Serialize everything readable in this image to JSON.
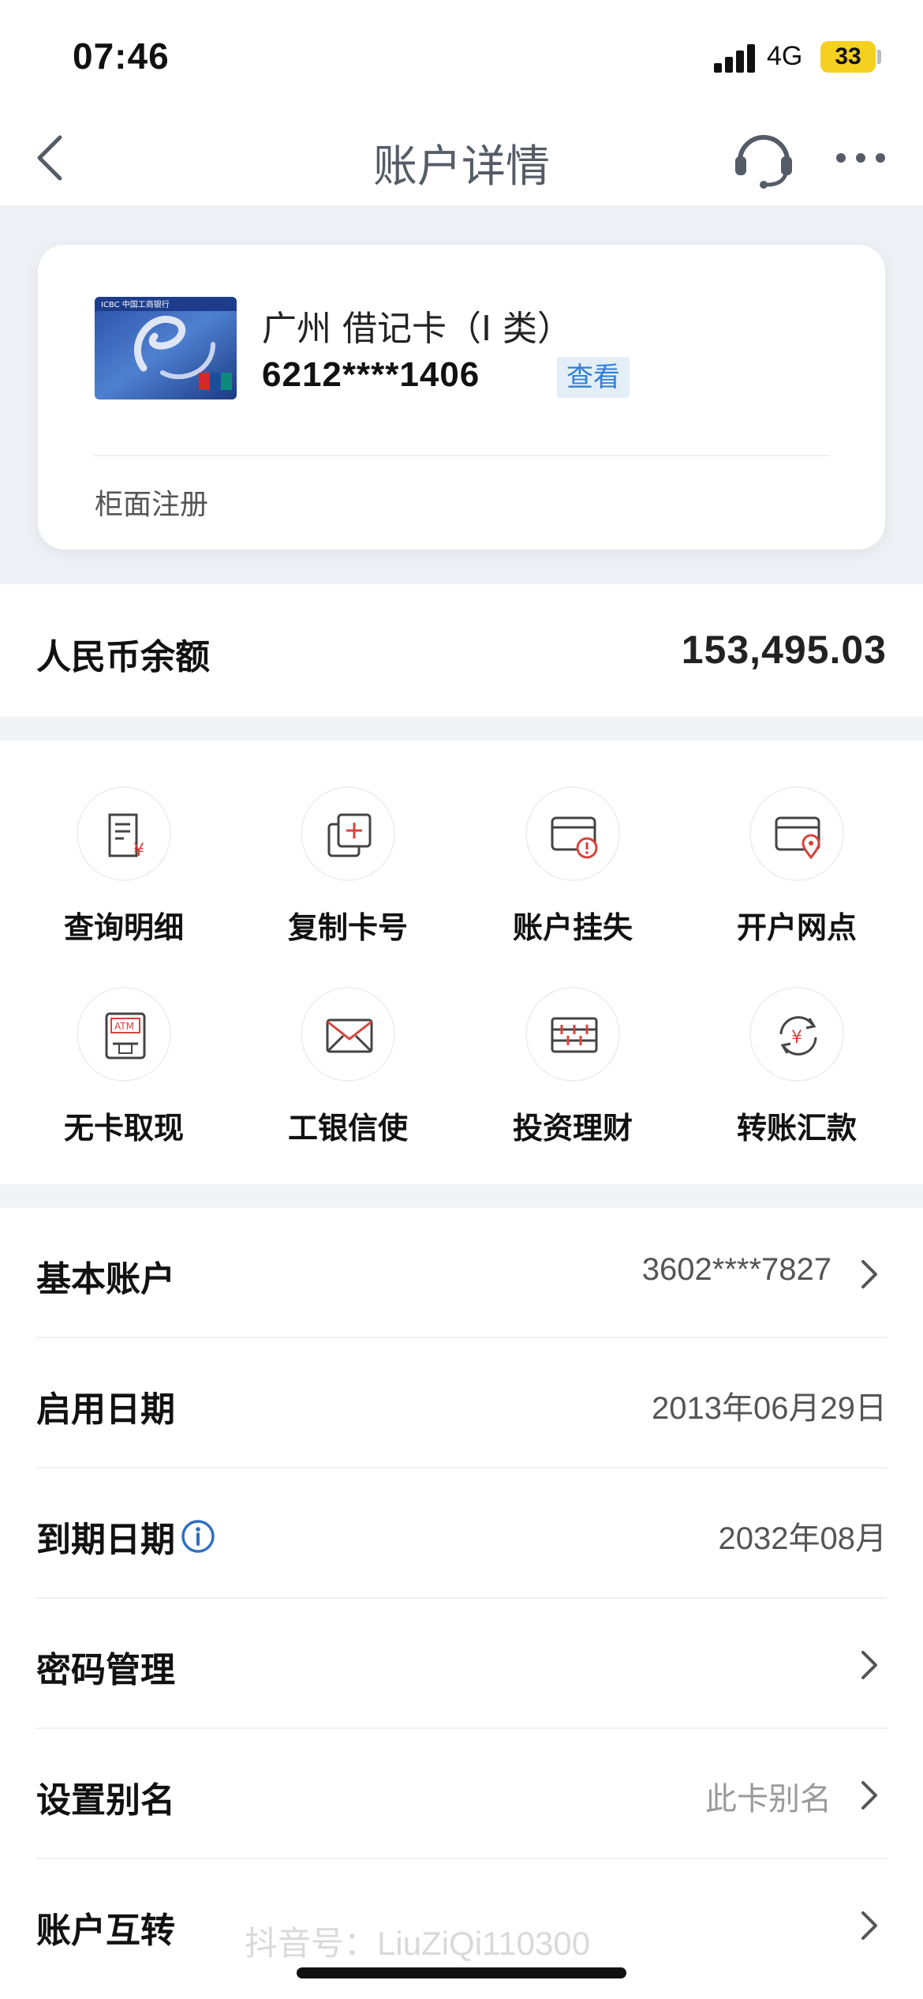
{
  "status_bar": {
    "time": "07:46",
    "network": "4G",
    "battery": "33"
  },
  "nav": {
    "title": "账户详情"
  },
  "card": {
    "name": "广州 借记卡（I 类）",
    "number": "6212****1406",
    "view_label": "查看",
    "registration": "柜面注册",
    "image_bank_text": "ICBC 中国工商银行"
  },
  "balance": {
    "label": "人民币余额",
    "value": "153,495.03"
  },
  "actions": [
    {
      "label": "查询明细",
      "icon": "statement-icon"
    },
    {
      "label": "复制卡号",
      "icon": "copy-icon"
    },
    {
      "label": "账户挂失",
      "icon": "card-alert-icon"
    },
    {
      "label": "开户网点",
      "icon": "card-location-icon"
    },
    {
      "label": "无卡取现",
      "icon": "atm-icon"
    },
    {
      "label": "工银信使",
      "icon": "envelope-icon"
    },
    {
      "label": "投资理财",
      "icon": "abacus-icon"
    },
    {
      "label": "转账汇款",
      "icon": "transfer-icon"
    }
  ],
  "atm_text": "ATM",
  "details": [
    {
      "label": "基本账户",
      "value": "3602****7827",
      "chevron": true
    },
    {
      "label": "启用日期",
      "value": "2013年06月29日",
      "chevron": false
    },
    {
      "label": "到期日期",
      "value": "2032年08月",
      "chevron": false,
      "info": true
    },
    {
      "label": "密码管理",
      "value": "",
      "chevron": true
    },
    {
      "label": "设置别名",
      "value": "此卡别名",
      "chevron": true,
      "placeholder": true
    },
    {
      "label": "账户互转",
      "value": "",
      "chevron": true
    }
  ],
  "watermark": "抖音号：LiuZiQi110300",
  "colors": {
    "accent_blue": "#2f7fd4",
    "icon_red": "#d8433b",
    "background": "#f2f3f7"
  }
}
